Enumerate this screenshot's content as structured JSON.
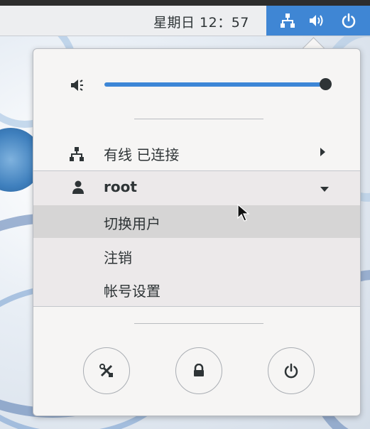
{
  "topbar": {
    "clock": "星期日 12：57",
    "tray_icons": [
      "network-wired-icon",
      "volume-icon",
      "power-icon"
    ]
  },
  "menu": {
    "volume": {
      "icon": "speaker-icon",
      "level": 1.0
    },
    "network": {
      "label": "有线 已连接",
      "icon": "network-wired-icon"
    },
    "user": {
      "name": "root",
      "items": [
        "切换用户",
        "注销",
        "帐号设置"
      ],
      "hovered_item": "切换用户"
    },
    "actions": [
      "settings-icon",
      "lock-icon",
      "power-icon"
    ]
  },
  "colors": {
    "accent": "#3f86d4",
    "menu_bg": "#f6f5f4",
    "hover": "#d6d5d5"
  }
}
